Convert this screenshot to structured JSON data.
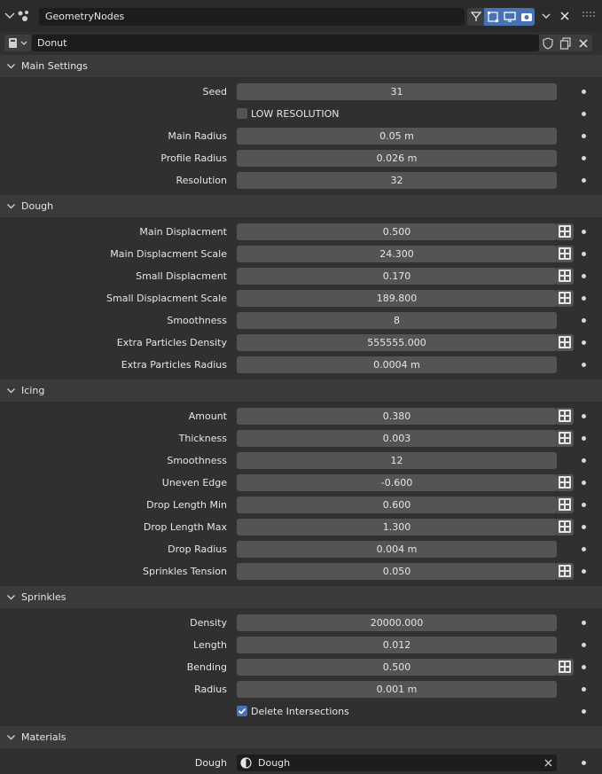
{
  "header": {
    "node_group_name": "GeometryNodes"
  },
  "group": {
    "name": "Donut"
  },
  "panels": [
    {
      "title": "Main Settings",
      "rows": [
        {
          "label": "Seed",
          "value": "31",
          "kind": "field",
          "tex": false
        },
        {
          "label": "",
          "value": "LOW RESOLUTION",
          "kind": "checkbox",
          "checked": false
        },
        {
          "label": "Main Radius",
          "value": "0.05 m",
          "kind": "field",
          "tex": false
        },
        {
          "label": "Profile Radius",
          "value": "0.026 m",
          "kind": "field",
          "tex": false
        },
        {
          "label": "Resolution",
          "value": "32",
          "kind": "field",
          "tex": false
        }
      ]
    },
    {
      "title": "Dough",
      "rows": [
        {
          "label": "Main Displacment",
          "value": "0.500",
          "kind": "field",
          "tex": true
        },
        {
          "label": "Main Displacment Scale",
          "value": "24.300",
          "kind": "field",
          "tex": true
        },
        {
          "label": "Small Displacment",
          "value": "0.170",
          "kind": "field",
          "tex": true
        },
        {
          "label": "Small Displacment Scale",
          "value": "189.800",
          "kind": "field",
          "tex": true
        },
        {
          "label": "Smoothness",
          "value": "8",
          "kind": "field",
          "tex": false
        },
        {
          "label": "Extra Particles Density",
          "value": "555555.000",
          "kind": "field",
          "tex": true
        },
        {
          "label": "Extra Particles Radius",
          "value": "0.0004 m",
          "kind": "field",
          "tex": false
        }
      ]
    },
    {
      "title": "Icing",
      "rows": [
        {
          "label": "Amount",
          "value": "0.380",
          "kind": "field",
          "tex": true
        },
        {
          "label": "Thickness",
          "value": "0.003",
          "kind": "field",
          "tex": true
        },
        {
          "label": "Smoothness",
          "value": "12",
          "kind": "field",
          "tex": false
        },
        {
          "label": "Uneven Edge",
          "value": "-0.600",
          "kind": "field",
          "tex": true
        },
        {
          "label": "Drop Length Min",
          "value": "0.600",
          "kind": "field",
          "tex": true
        },
        {
          "label": "Drop Length  Max",
          "value": "1.300",
          "kind": "field",
          "tex": true
        },
        {
          "label": "Drop Radius",
          "value": "0.004 m",
          "kind": "field",
          "tex": false
        },
        {
          "label": "Sprinkles Tension",
          "value": "0.050",
          "kind": "field",
          "tex": true
        }
      ]
    },
    {
      "title": "Sprinkles",
      "rows": [
        {
          "label": "Density",
          "value": "20000.000",
          "kind": "field",
          "tex": false
        },
        {
          "label": "Length",
          "value": "0.012",
          "kind": "field",
          "tex": false
        },
        {
          "label": "Bending",
          "value": "0.500",
          "kind": "field",
          "tex": true
        },
        {
          "label": "Radius",
          "value": "0.001 m",
          "kind": "field",
          "tex": false
        },
        {
          "label": "",
          "value": "Delete Intersections",
          "kind": "checkbox",
          "checked": true
        }
      ]
    },
    {
      "title": "Materials",
      "rows": [
        {
          "label": "Dough",
          "value": "Dough",
          "kind": "material"
        }
      ]
    }
  ],
  "colors": {
    "accent": "#4772b3",
    "field": "#545454",
    "panel_header": "#3a3a3a",
    "background": "#303030"
  }
}
